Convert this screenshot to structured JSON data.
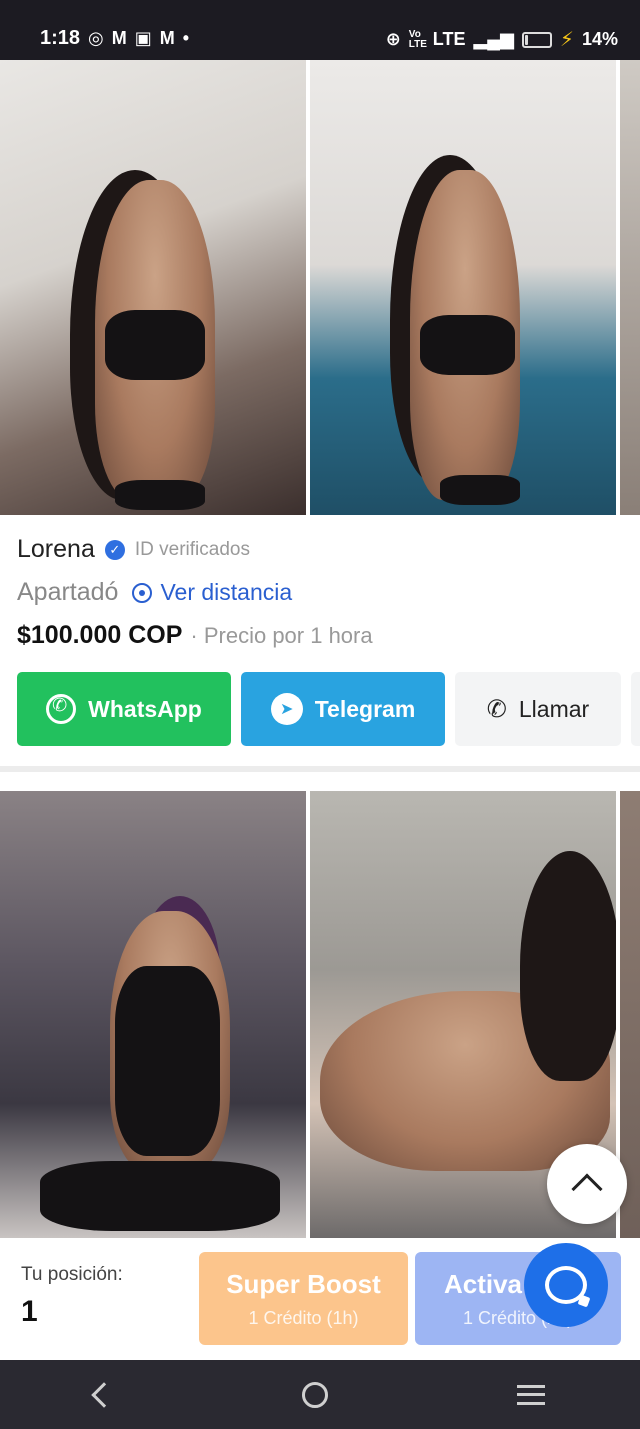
{
  "status_bar": {
    "time": "1:18",
    "notification_icons": [
      "whatsapp-icon",
      "gmail-icon",
      "news-icon",
      "gmail-icon",
      "dot-icon"
    ],
    "network": "LTE",
    "volte": "Vo LTE",
    "battery_percent": "14%",
    "battery_level": 0.14
  },
  "listing": {
    "name": "Lorena",
    "verified_label": "ID verificados",
    "city": "Apartadó",
    "distance_link": "Ver distancia",
    "price": "$100.000 COP",
    "price_note": "· Precio por 1 hora",
    "buttons": {
      "whatsapp": "WhatsApp",
      "telegram": "Telegram",
      "call": "Llamar"
    }
  },
  "bottom_panel": {
    "position_label": "Tu posición:",
    "position_value": "1",
    "super_boost": {
      "title": "Super Boost",
      "subtitle": "1 Crédito (1h)"
    },
    "activa": {
      "title": "Activa",
      "subtitle": "1 Crédito (2h)"
    }
  },
  "colors": {
    "whatsapp": "#22c15e",
    "telegram": "#29a3e0",
    "link_blue": "#2a5fd0",
    "super_boost": "#fcc58c",
    "activa": "#9db5f3",
    "chat_fab": "#1e6fe8"
  }
}
